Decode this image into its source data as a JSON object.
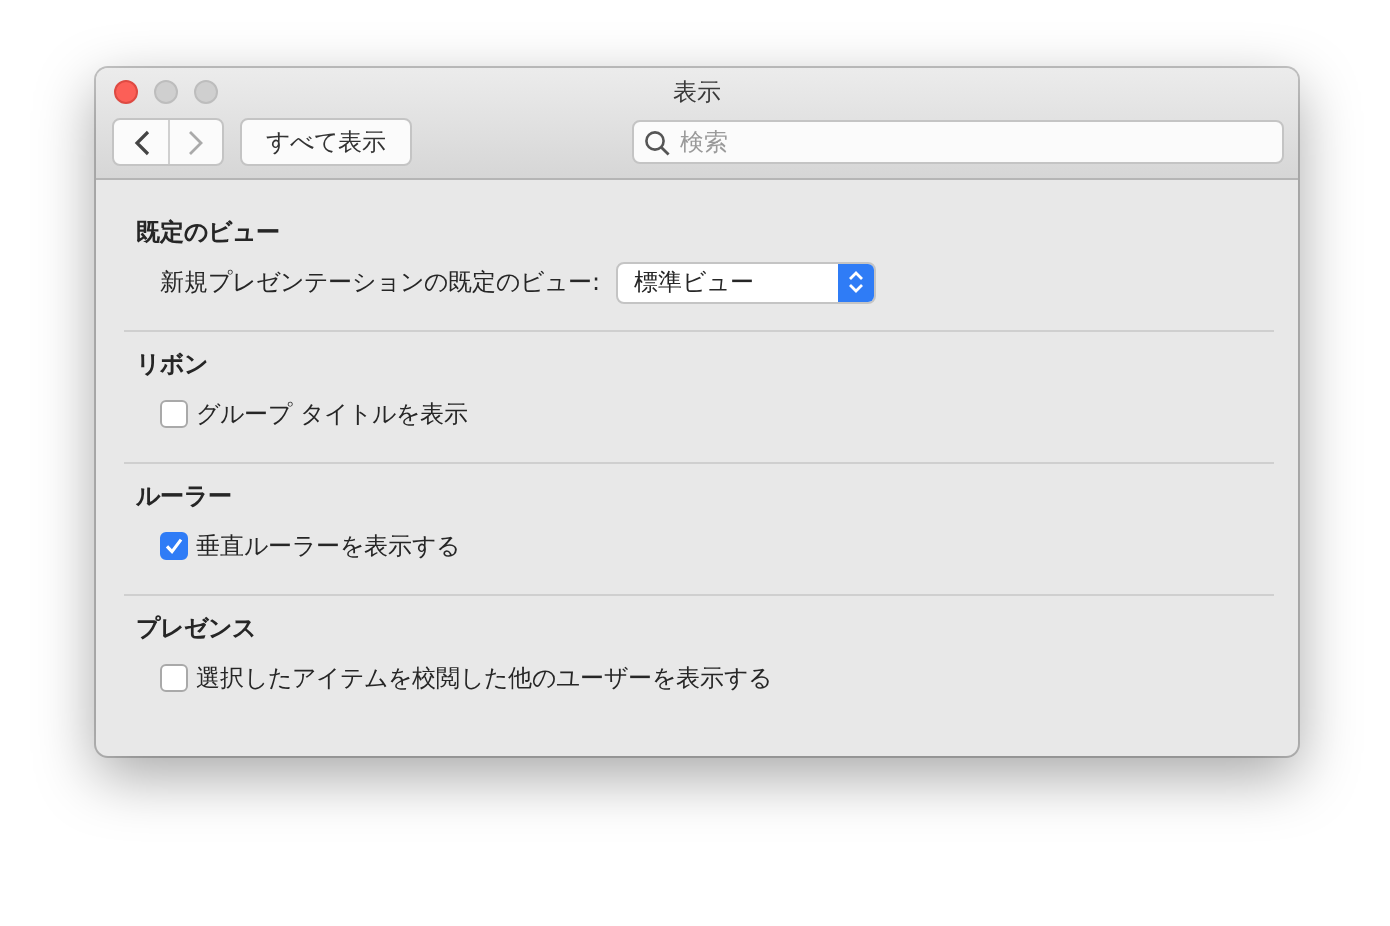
{
  "window": {
    "title": "表示"
  },
  "toolbar": {
    "show_all": "すべて表示",
    "search": {
      "placeholder": "検索"
    }
  },
  "sections": [
    {
      "heading": "既定のビュー",
      "kind": "select",
      "label": "新規プレゼンテーションの既定のビュー:",
      "value": "標準ビュー"
    },
    {
      "heading": "リボン",
      "kind": "checkbox",
      "label": "グループ タイトルを表示",
      "checked": false
    },
    {
      "heading": "ルーラー",
      "kind": "checkbox",
      "label": "垂直ルーラーを表示する",
      "checked": true
    },
    {
      "heading": "プレゼンス",
      "kind": "checkbox",
      "label": "選択したアイテムを校閲した他のユーザーを表示する",
      "checked": false
    }
  ]
}
